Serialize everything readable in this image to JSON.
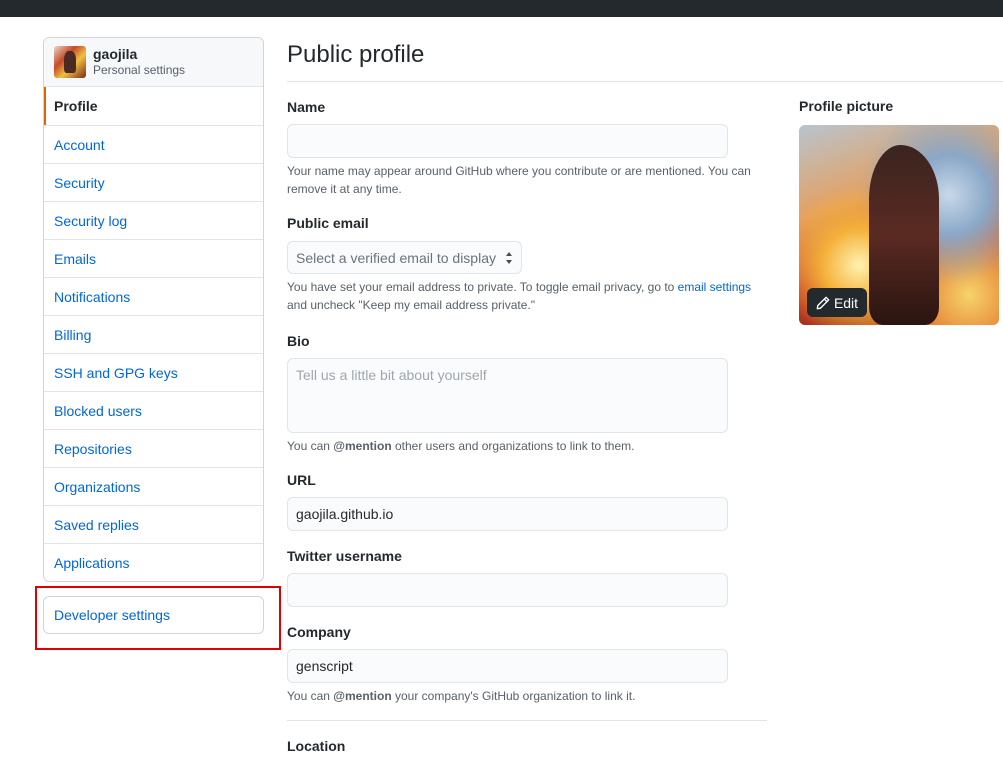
{
  "sidebar": {
    "user": {
      "name": "gaojila",
      "subtitle": "Personal settings"
    },
    "items": [
      {
        "label": "Profile",
        "selected": true
      },
      {
        "label": "Account"
      },
      {
        "label": "Security"
      },
      {
        "label": "Security log"
      },
      {
        "label": "Emails"
      },
      {
        "label": "Notifications"
      },
      {
        "label": "Billing"
      },
      {
        "label": "SSH and GPG keys"
      },
      {
        "label": "Blocked users"
      },
      {
        "label": "Repositories"
      },
      {
        "label": "Organizations"
      },
      {
        "label": "Saved replies"
      },
      {
        "label": "Applications"
      }
    ],
    "developer_settings": "Developer settings"
  },
  "main": {
    "title": "Public profile",
    "name": {
      "label": "Name",
      "value": "",
      "note": "Your name may appear around GitHub where you contribute or are mentioned. You can remove it at any time."
    },
    "public_email": {
      "label": "Public email",
      "selected": "Select a verified email to display",
      "note_before": "You have set your email address to private. To toggle email privacy, go to",
      "note_link": "email settings",
      "note_after": "and uncheck \"Keep my email address private.\""
    },
    "bio": {
      "label": "Bio",
      "placeholder": "Tell us a little bit about yourself",
      "note_before": "You can",
      "note_mention": "@mention",
      "note_after": "other users and organizations to link to them."
    },
    "url": {
      "label": "URL",
      "value": "gaojila.github.io"
    },
    "twitter": {
      "label": "Twitter username",
      "value": ""
    },
    "company": {
      "label": "Company",
      "value": "genscript",
      "note_before": "You can",
      "note_mention": "@mention",
      "note_after": "your company's GitHub organization to link it."
    },
    "location": {
      "label": "Location"
    }
  },
  "profile_picture": {
    "label": "Profile picture",
    "edit_label": "Edit"
  },
  "colors": {
    "link": "#0366d6",
    "topbar": "#24292e",
    "selected_accent": "#e36209",
    "highlight_box": "#e00000"
  }
}
